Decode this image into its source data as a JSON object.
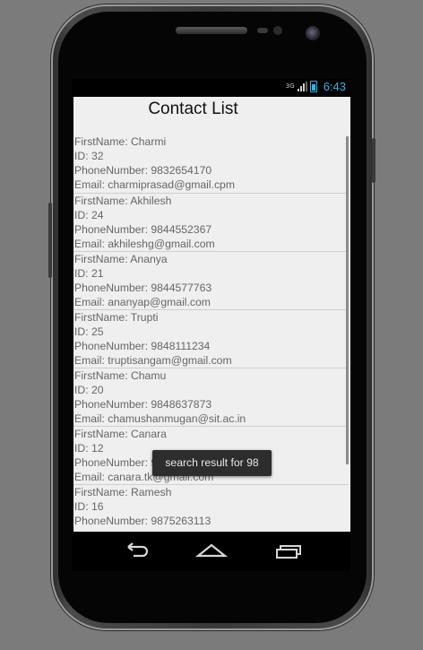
{
  "status_bar": {
    "network": "3G",
    "time": "6:43",
    "clock_color": "#33b5e5",
    "icons": [
      "signal-icon",
      "battery-icon"
    ]
  },
  "app": {
    "title": "Contact List"
  },
  "contacts": [
    {
      "first_name": "FirstName: Charmi",
      "id": "ID: 32",
      "phone": "PhoneNumber: 9832654170",
      "email": "Email: charmiprasad@gmail.cpm"
    },
    {
      "first_name": "FirstName: Akhilesh",
      "id": "ID: 24",
      "phone": "PhoneNumber: 9844552367",
      "email": "Email: akhileshg@gmail.com"
    },
    {
      "first_name": "FirstName: Ananya",
      "id": "ID: 21",
      "phone": "PhoneNumber: 9844577763",
      "email": "Email: ananyap@gmail.com"
    },
    {
      "first_name": "FirstName: Trupti",
      "id": "ID: 25",
      "phone": "PhoneNumber: 9848111234",
      "email": "Email: truptisangam@gmail.com"
    },
    {
      "first_name": "FirstName: Chamu",
      "id": "ID: 20",
      "phone": "PhoneNumber: 9848637873",
      "email": "Email: chamushanmugan@sit.ac.in"
    },
    {
      "first_name": "FirstName: Canara",
      "id": "ID: 12",
      "phone": "PhoneNumber: 9",
      "email": "Email: canara.tk@gmail.com"
    },
    {
      "first_name": "FirstName: Ramesh",
      "id": "ID: 16",
      "phone": "PhoneNumber: 9875263113",
      "email": ""
    }
  ],
  "toast": {
    "message": "search result for 98"
  },
  "nav_bar": {
    "icons": [
      "back-icon",
      "home-icon",
      "recent-apps-icon"
    ]
  }
}
